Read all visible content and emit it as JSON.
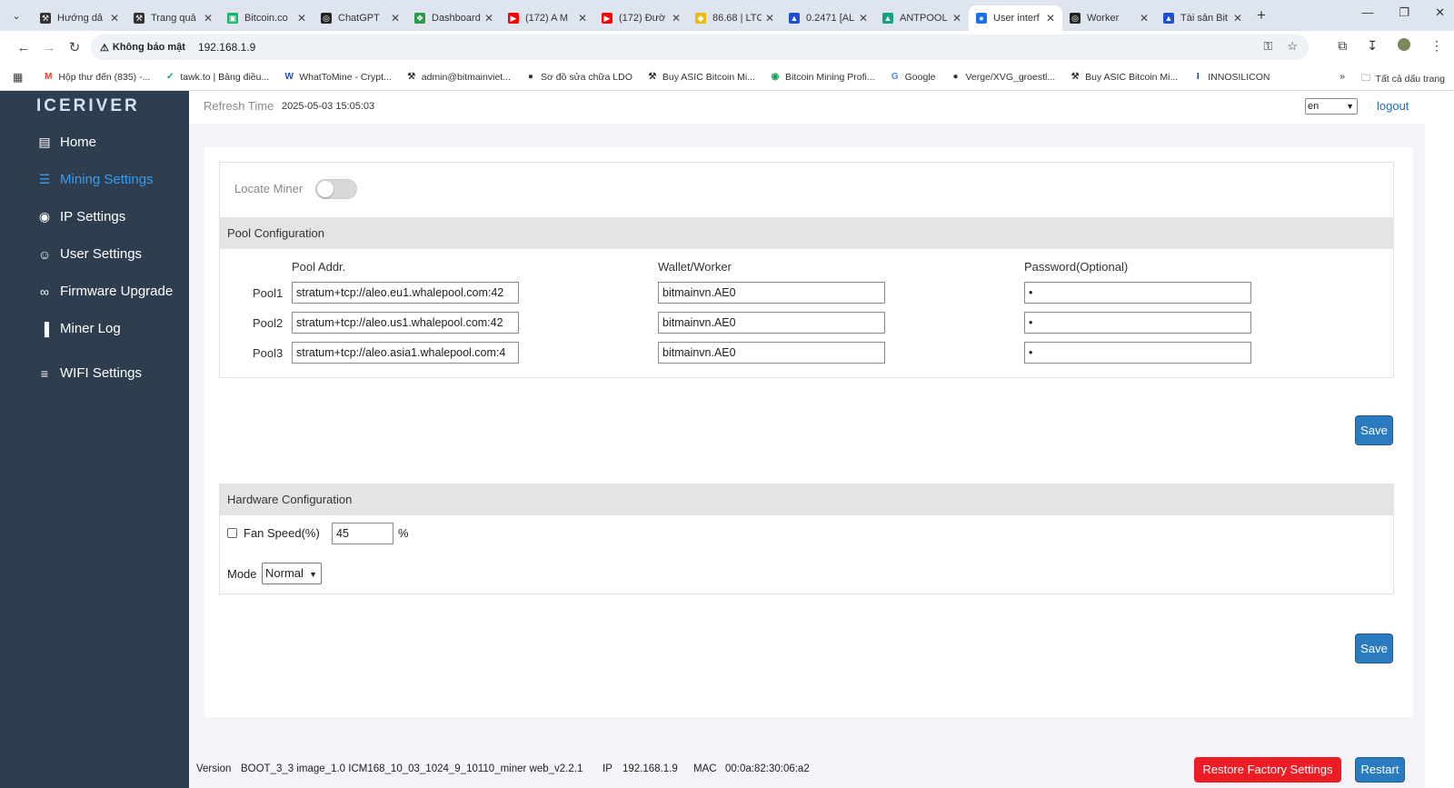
{
  "browser": {
    "tabs": [
      {
        "title": "Hướng dẫ",
        "icon": "miner-icon",
        "color": "#333333"
      },
      {
        "title": "Trang quả",
        "icon": "miner-icon",
        "color": "#333333"
      },
      {
        "title": "Bitcoin.co",
        "icon": "bitcoin-com-icon",
        "color": "#1ab26b"
      },
      {
        "title": "ChatGPT",
        "icon": "chatgpt-icon",
        "color": "#222222"
      },
      {
        "title": "Dashboard",
        "icon": "dashboard-icon",
        "color": "#2e9b48"
      },
      {
        "title": "(172) A M",
        "icon": "youtube-icon",
        "color": "#ff0000"
      },
      {
        "title": "(172) Đườ",
        "icon": "youtube-icon",
        "color": "#ff0000"
      },
      {
        "title": "86.68 | LTC",
        "icon": "binance-icon",
        "color": "#f0b90b"
      },
      {
        "title": "0.2471 [AL",
        "icon": "mountain-icon",
        "color": "#1b4fd6"
      },
      {
        "title": "ANTPOOL",
        "icon": "antpool-icon",
        "color": "#16a085"
      },
      {
        "title": "User interf",
        "icon": "globe-icon",
        "color": "#1a73e8"
      },
      {
        "title": "Worker",
        "icon": "worker-icon",
        "color": "#222222"
      },
      {
        "title": "Tài sản Bit",
        "icon": "mountain-icon",
        "color": "#1b4fd6"
      }
    ],
    "active_tab_index": 10,
    "security_warning": "Không bảo mật",
    "url": "192.168.1.9",
    "bookmarks": [
      {
        "label": "Hộp thư đến (835) -...",
        "icon": "gmail-icon",
        "color": "#ea4335"
      },
      {
        "label": "tawk.to | Bảng điều...",
        "icon": "tawk-icon",
        "color": "#03a84e"
      },
      {
        "label": "WhatToMine - Crypt...",
        "icon": "whattomine-icon",
        "color": "#1b4fd6"
      },
      {
        "label": "admin@bitmainviet...",
        "icon": "miner-icon",
        "color": "#333333"
      },
      {
        "label": "Sơ đồ sửa chữa LDO",
        "icon": "globe-icon",
        "color": "#333333"
      },
      {
        "label": "Buy ASIC Bitcoin Mi...",
        "icon": "miner-icon",
        "color": "#333333"
      },
      {
        "label": "Bitcoin Mining Profi...",
        "icon": "mining-profit-icon",
        "color": "#18a058"
      },
      {
        "label": "Google",
        "icon": "google-icon",
        "color": "#4285f4"
      },
      {
        "label": "Verge/XVG_groestl...",
        "icon": "globe-icon",
        "color": "#333333"
      },
      {
        "label": "Buy ASIC Bitcoin Mi...",
        "icon": "miner-icon",
        "color": "#333333"
      },
      {
        "label": "INNOSILICON",
        "icon": "innosilicon-icon",
        "color": "#1a3c8c"
      }
    ],
    "all_bookmarks_label": "Tất cả dấu trang"
  },
  "app": {
    "logo": "ICERIVER",
    "refresh_label": "Refresh Time",
    "refresh_time": "2025-05-03 15:05:03",
    "language": "en",
    "logout": "logout",
    "nav": [
      {
        "label": "Home",
        "icon": "monitor-icon",
        "active": false
      },
      {
        "label": "Mining Settings",
        "icon": "server-icon",
        "active": true
      },
      {
        "label": "IP Settings",
        "icon": "location-pin-icon",
        "active": false
      },
      {
        "label": "User Settings",
        "icon": "user-gear-icon",
        "active": false
      },
      {
        "label": "Firmware Upgrade",
        "icon": "link-icon",
        "active": false
      },
      {
        "label": "Miner Log",
        "icon": "bar-chart-icon",
        "active": false
      },
      {
        "label": "WIFI Settings",
        "icon": "wifi-router-icon",
        "active": false
      }
    ],
    "accent_color": "#3a9bef"
  },
  "pool_section": {
    "locate_miner_label": "Locate Miner",
    "locate_miner_on": false,
    "title": "Pool Configuration",
    "col_pool_addr": "Pool Addr.",
    "col_wallet": "Wallet/Worker",
    "col_password": "Password(Optional)",
    "pools": [
      {
        "label": "Pool1",
        "addr": "stratum+tcp://aleo.eu1.whalepool.com:42",
        "wallet": "bitmainvn.AE0",
        "password": "•"
      },
      {
        "label": "Pool2",
        "addr": "stratum+tcp://aleo.us1.whalepool.com:42",
        "wallet": "bitmainvn.AE0",
        "password": "•"
      },
      {
        "label": "Pool3",
        "addr": "stratum+tcp://aleo.asia1.whalepool.com:4",
        "wallet": "bitmainvn.AE0",
        "password": "•"
      }
    ],
    "save_label": "Save"
  },
  "hardware_section": {
    "title": "Hardware Configuration",
    "fan_speed_label": "Fan Speed(%)",
    "fan_speed_checked": false,
    "fan_speed_value": "45",
    "fan_speed_unit": "%",
    "mode_label": "Mode",
    "mode_value": "Normal",
    "save_label": "Save"
  },
  "footer": {
    "version_label": "Version",
    "version_value": "BOOT_3_3 image_1.0 ICM168_10_03_1024_9_10110_miner web_v2.2.1",
    "ip_label": "IP",
    "ip_value": "192.168.1.9",
    "mac_label": "MAC",
    "mac_value": "00:0a:82:30:06:a2",
    "restore_label": "Restore Factory Settings",
    "restart_label": "Restart",
    "restore_color": "#ee1c24",
    "restart_color": "#2a7bbf"
  }
}
